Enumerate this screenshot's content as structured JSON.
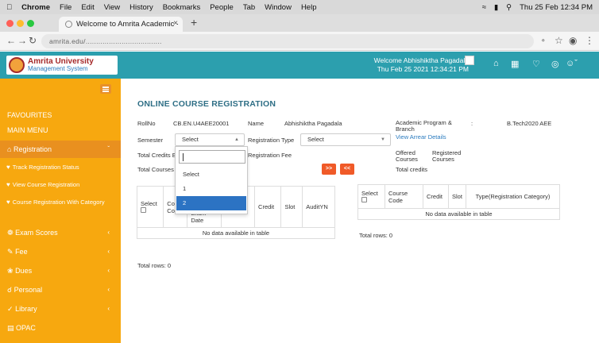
{
  "menubar": {
    "app": "Chrome",
    "items": [
      "File",
      "Edit",
      "View",
      "History",
      "Bookmarks",
      "People",
      "Tab",
      "Window",
      "Help"
    ],
    "datetime": "Thu 25 Feb  12:34 PM"
  },
  "browser": {
    "tab_title": "Welcome to Amrita Academic ·",
    "url": "amrita.edu/...................................."
  },
  "header": {
    "logo_line1": "Amrita University",
    "logo_line2": "Management System",
    "welcome": "Welcome Abhishiktha Pagadala",
    "datetime": "Thu Feb 25 2021 12:34:21 PM"
  },
  "sidebar": {
    "favourites": "FAVOURITES",
    "main_menu": "MAIN MENU",
    "registration": "Registration",
    "sub": [
      "Track Registration Status",
      "View Course Registration",
      "Course Registration With Category"
    ],
    "items": [
      "Exam Scores",
      "Fee",
      "Dues",
      "Personal",
      "Library",
      "OPAC"
    ]
  },
  "page": {
    "title": "ONLINE COURSE REGISTRATION",
    "rollno_label": "RollNo",
    "rollno": "CB.EN.U4AEE20001",
    "name_label": "Name",
    "name": "Abhishiktha Pagadala",
    "program_label": "Academic Program & Branch",
    "program_colon": ":",
    "program": "B.Tech2020 AEE",
    "semester_label": "Semester",
    "semester_value": "Select",
    "regtype_label": "Registration Type",
    "regtype_value": "Select",
    "view_arrear": "View Arrear Details",
    "total_credits_label": "Total Credits E",
    "reg_fee_label": "Registration Fee",
    "offered_courses": "Offered Courses",
    "registered_courses": "Registered Courses",
    "total_credits2": "Total credits",
    "total_courses_label": "Total Courses",
    "btn_forward": ">>",
    "btn_back": "<<"
  },
  "dropdown": {
    "search": "",
    "options": [
      "Select",
      "1",
      "2"
    ],
    "selected": "2"
  },
  "left_table": {
    "headers": [
      "Select",
      "Co Code",
      "Exam Date",
      "se Pattern",
      "Credit",
      "Slot",
      "AuditYN"
    ],
    "empty": "No data available in table",
    "total_rows": "Total rows: 0"
  },
  "right_table": {
    "headers": [
      "Select",
      "Course Code",
      "Credit",
      "Slot",
      "Type(Registration Category)"
    ],
    "empty": "No data available in table",
    "total_rows": "Total rows: 0"
  }
}
